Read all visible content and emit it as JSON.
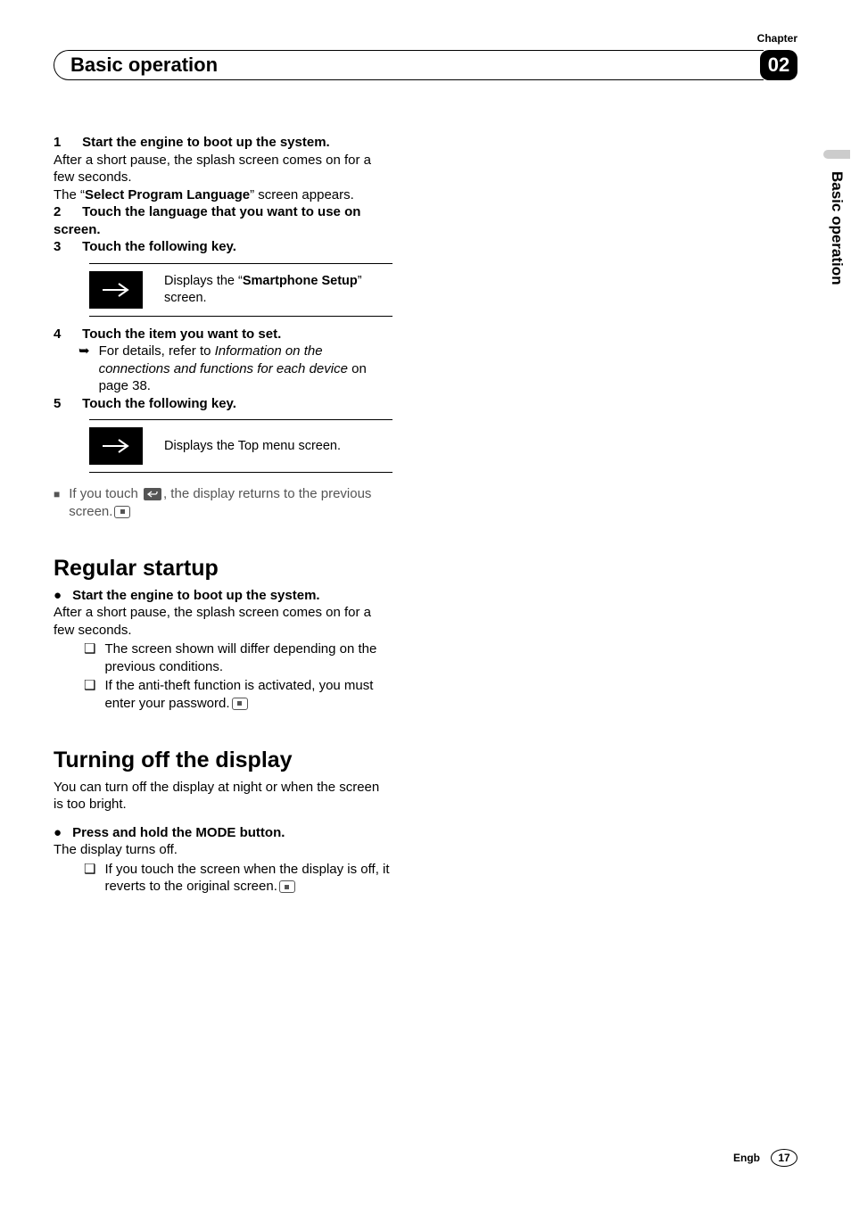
{
  "header": {
    "chapter_label": "Chapter",
    "title": "Basic operation",
    "chapter_number": "02"
  },
  "side_tab": "Basic operation",
  "steps": {
    "s1": {
      "num": "1",
      "title": "Start the engine to boot up the system.",
      "body_a": "After a short pause, the splash screen comes on for a few seconds.",
      "body_b_pre": "The “",
      "body_b_bold": "Select Program Language",
      "body_b_post": "” screen appears."
    },
    "s2": {
      "num": "2",
      "title": "Touch the language that you want to use on screen."
    },
    "s3": {
      "num": "3",
      "title": "Touch the following key.",
      "key_desc_pre": "Displays the “",
      "key_desc_bold": "Smartphone Setup",
      "key_desc_post": "” screen."
    },
    "s4": {
      "num": "4",
      "title": "Touch the item you want to set.",
      "sub_pre": "For details, refer to ",
      "sub_italic": "Information on the connections and functions for each device",
      "sub_post": " on page 38."
    },
    "s5": {
      "num": "5",
      "title": "Touch the following key.",
      "key_desc": "Displays the Top menu screen."
    },
    "note": {
      "pre": "If you touch ",
      "post": ", the display returns to the previous screen."
    }
  },
  "section_regular": {
    "heading": "Regular startup",
    "bullet_title": "Start the engine to boot up the system.",
    "body": "After a short pause, the splash screen comes on for a few seconds.",
    "note1": "The screen shown will differ depending on the previous conditions.",
    "note2": "If the anti-theft function is activated, you must enter your password."
  },
  "section_turnoff": {
    "heading": "Turning off the display",
    "intro": "You can turn off the display at night or when the screen is too bright.",
    "bullet_title": "Press and hold the MODE button.",
    "body": "The display turns off.",
    "note1": "If you touch the screen when the display is off, it reverts to the original screen."
  },
  "footer": {
    "lang": "Engb",
    "page": "17"
  }
}
